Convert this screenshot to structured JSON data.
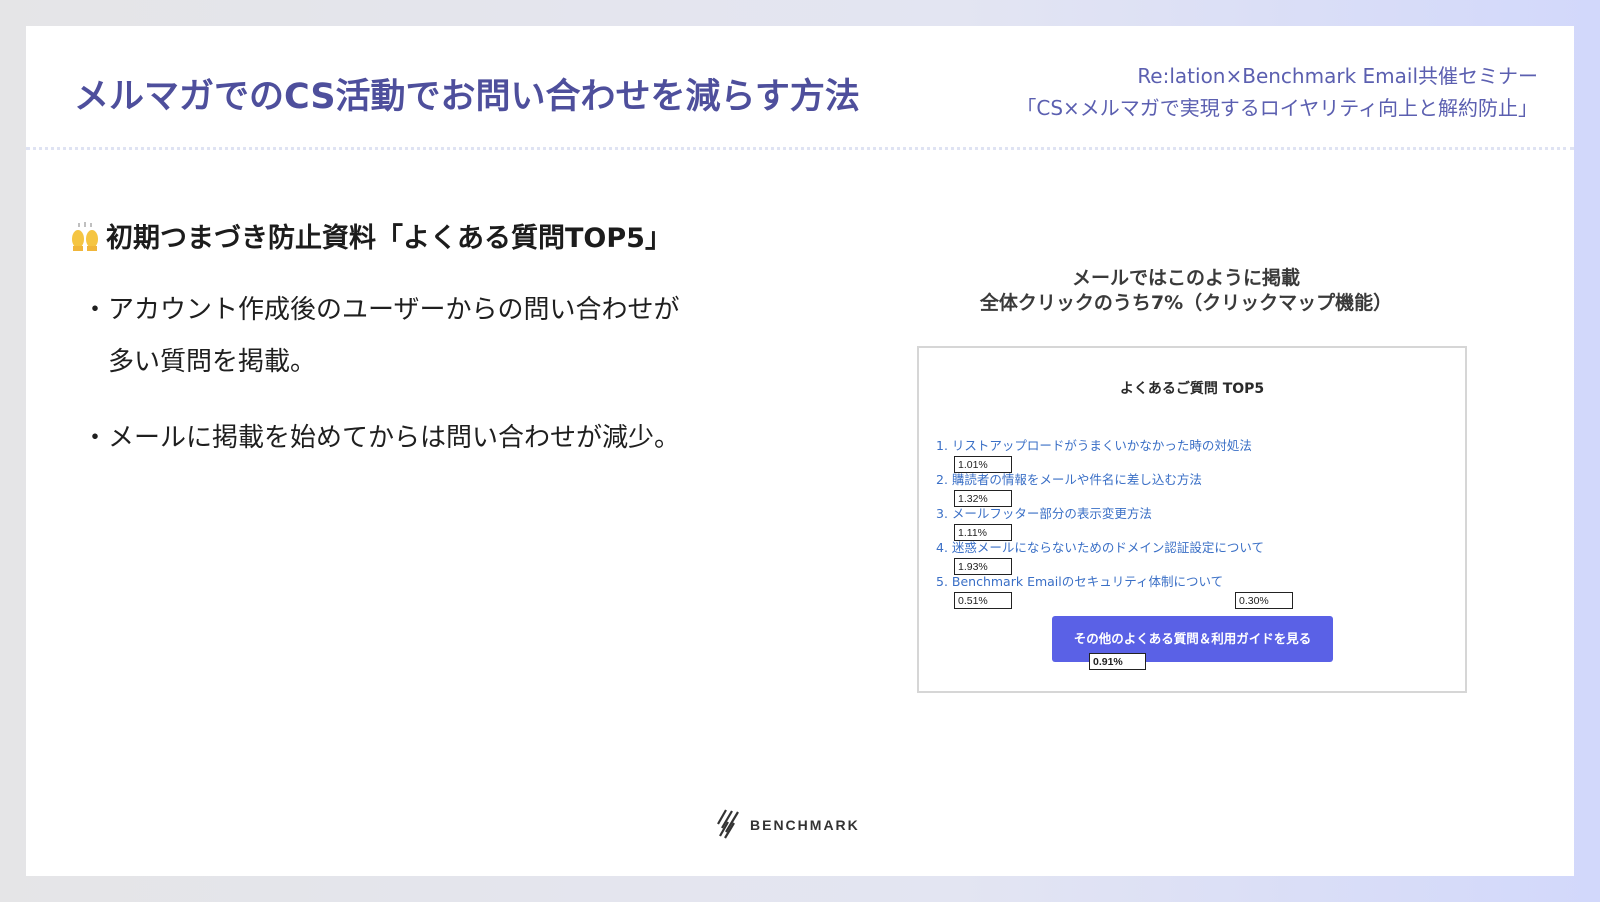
{
  "slide": {
    "title": "メルマガでのCS活動でお問い合わせを減らす方法",
    "seminar_line1": "Re:lation×Benchmark Email共催セミナー",
    "seminar_line2": "「CS×メルマガで実現するロイヤリティ向上と解約防止」"
  },
  "section": {
    "emoji_icon": "raising-hands-icon",
    "heading": "初期つまづき防止資料「よくある質問TOP5」"
  },
  "bullets": [
    {
      "line1": "・アカウント作成後のユーザーからの問い合わせが",
      "line2": "多い質問を掲載。"
    },
    {
      "line1": "・メールに掲載を始めてからは問い合わせが減少。"
    }
  ],
  "caption": {
    "line1": "メールではこのように掲載",
    "line2": "全体クリックのうち7%（クリックマップ機能）"
  },
  "mail": {
    "title": "よくあるご質問 TOP5",
    "faq": [
      "1. リストアップロードがうまくいかなかった時の対処法",
      "2. 購読者の情報をメールや件名に差し込む方法",
      "3. メールフッター部分の表示変更方法",
      "4. 迷惑メールにならないためのドメイン認証設定について",
      "5. Benchmark Emailのセキュリティ体制について"
    ],
    "click_rates": [
      "1.01%",
      "1.32%",
      "1.11%",
      "1.93%",
      "0.51%"
    ],
    "side_rate": "0.30%",
    "cta_label": "その他のよくある質問＆利用ガイドを見る",
    "cta_rate": "0.91%",
    "button_color": "#5a61e6",
    "link_color": "#3a6fc6"
  },
  "footer": {
    "logo_icon": "benchmark-logo-icon",
    "logo_text": "BENCHMARK"
  }
}
